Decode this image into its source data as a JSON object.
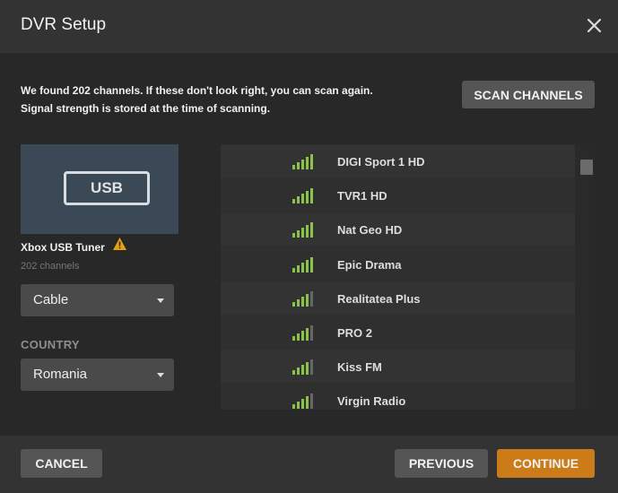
{
  "header": {
    "title": "DVR Setup"
  },
  "message": {
    "line1": "We found 202 channels. If these don't look right, you can scan again.",
    "line2": "Signal strength is stored at the time of scanning."
  },
  "actions": {
    "scan_label": "SCAN CHANNELS",
    "cancel_label": "CANCEL",
    "previous_label": "PREVIOUS",
    "continue_label": "CONTINUE"
  },
  "tuner": {
    "badge": "USB",
    "name": "Xbox USB Tuner",
    "count": "202 channels",
    "warning_icon": "warning-triangle-icon"
  },
  "source_select": {
    "value": "Cable"
  },
  "country": {
    "label": "COUNTRY",
    "value": "Romania"
  },
  "channels": [
    {
      "name": "DIGI Sport 1 HD",
      "signal_bars": 5
    },
    {
      "name": "TVR1 HD",
      "signal_bars": 5
    },
    {
      "name": "Nat Geo HD",
      "signal_bars": 5
    },
    {
      "name": "Epic Drama",
      "signal_bars": 5
    },
    {
      "name": "Realitatea Plus",
      "signal_bars": 4
    },
    {
      "name": "PRO 2",
      "signal_bars": 4
    },
    {
      "name": "Kiss FM",
      "signal_bars": 4
    },
    {
      "name": "Virgin Radio",
      "signal_bars": 4
    }
  ],
  "colors": {
    "accent": "#cc7b19",
    "signal_on": "#8bc34a",
    "signal_off": "#666666",
    "warning": "#e5a00d"
  }
}
